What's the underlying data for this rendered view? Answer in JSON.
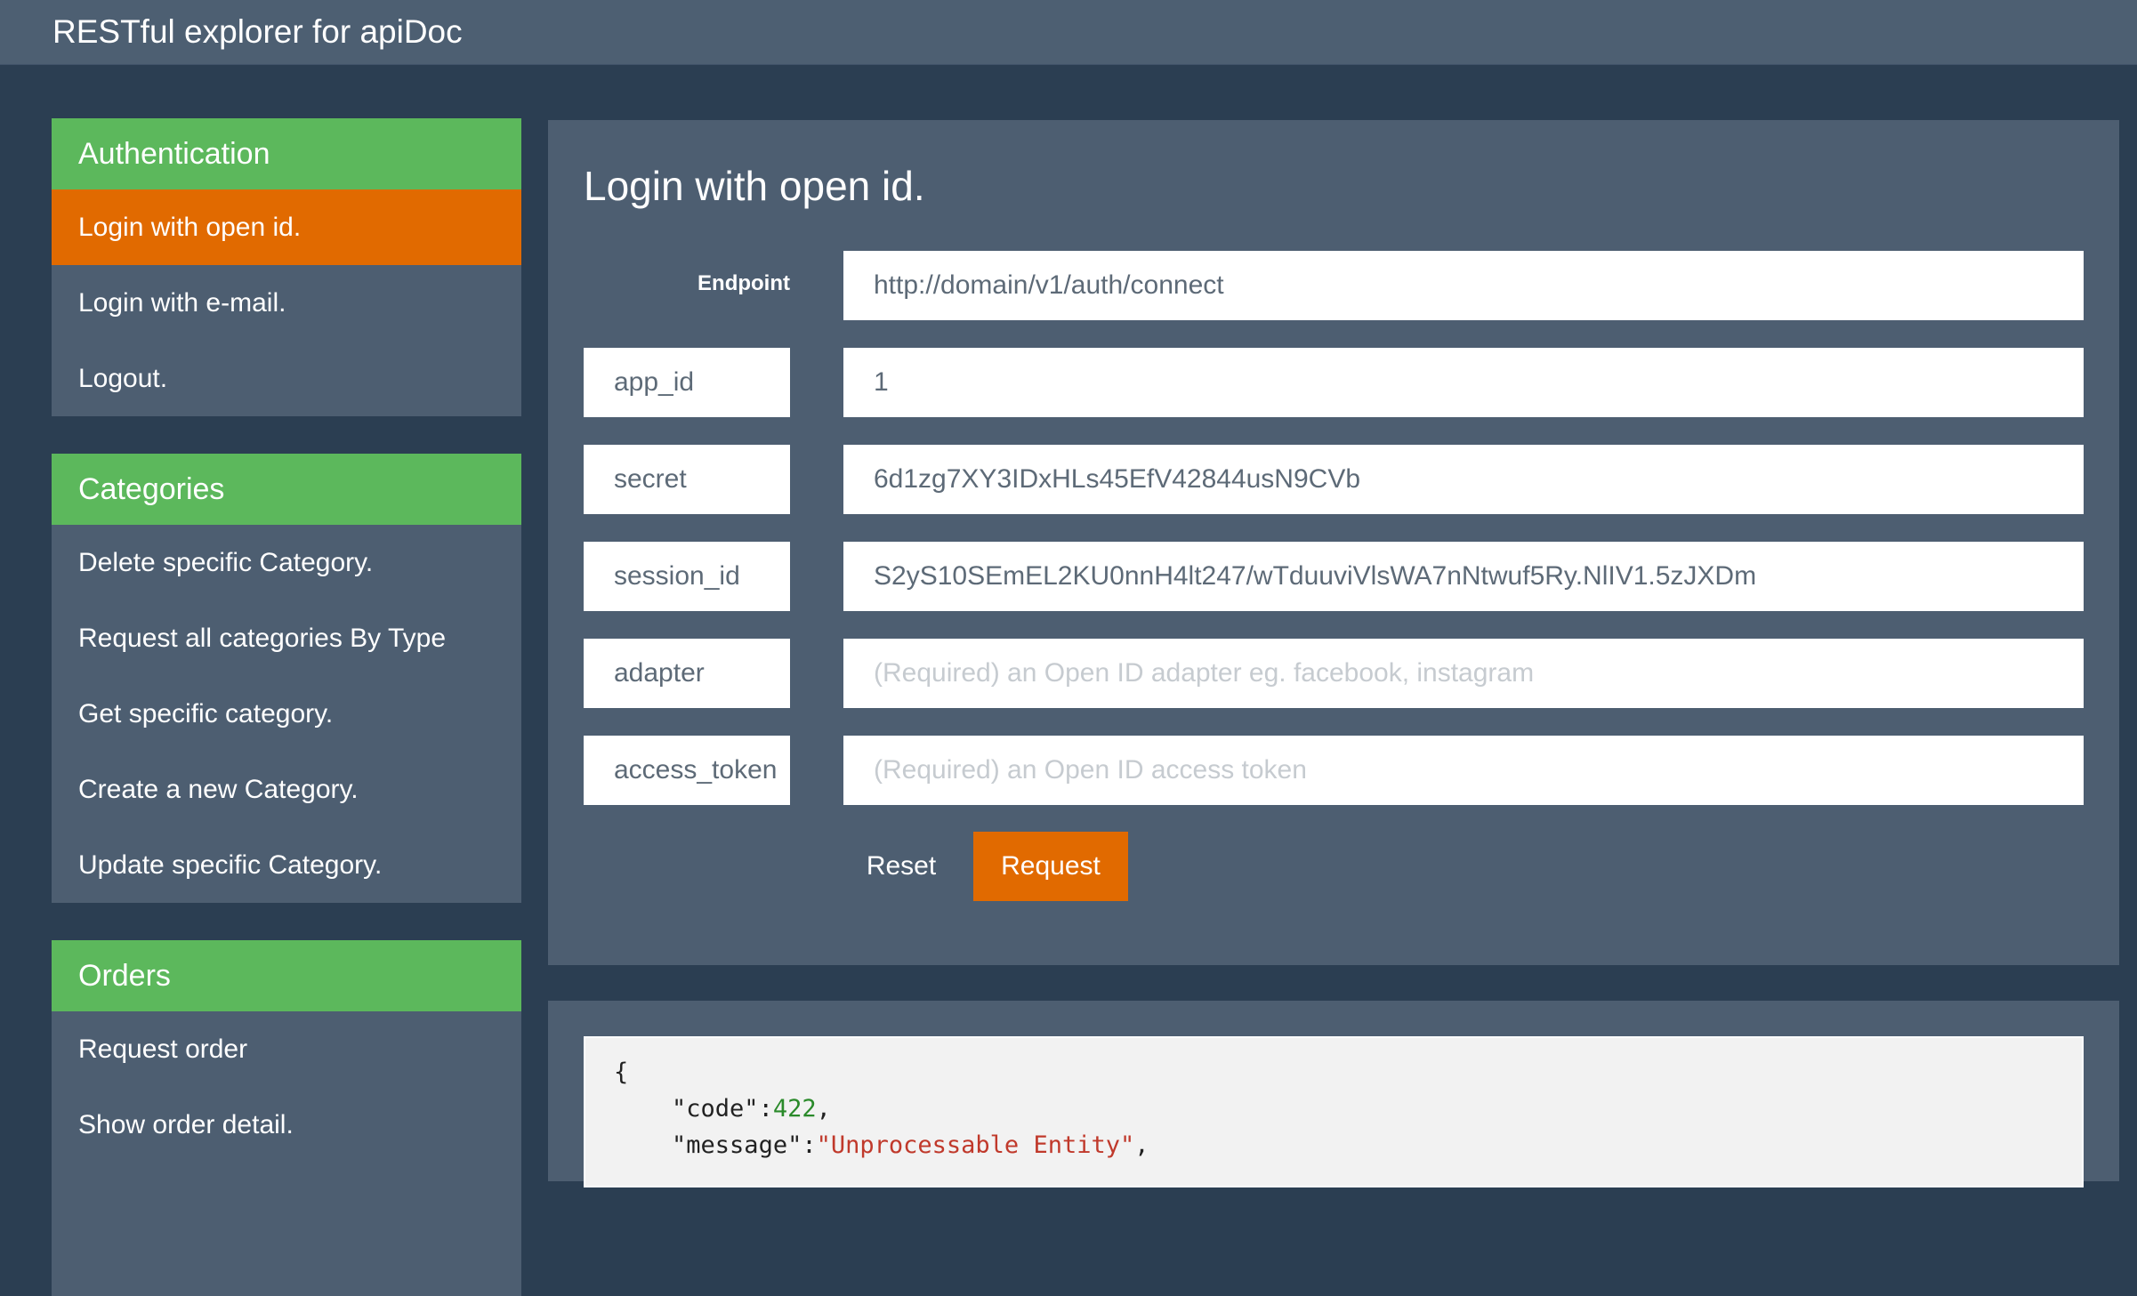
{
  "app": {
    "title": "RESTful explorer for apiDoc"
  },
  "sidebar": {
    "groups": [
      {
        "title": "Authentication",
        "items": [
          {
            "label": "Login with open id.",
            "active": true
          },
          {
            "label": "Login with e-mail."
          },
          {
            "label": "Logout."
          }
        ]
      },
      {
        "title": "Categories",
        "items": [
          {
            "label": "Delete specific Category."
          },
          {
            "label": "Request all categories By Type"
          },
          {
            "label": "Get specific category."
          },
          {
            "label": "Create a new Category."
          },
          {
            "label": "Update specific Category."
          }
        ]
      },
      {
        "title": "Orders",
        "items": [
          {
            "label": "Request order"
          },
          {
            "label": "Show order detail."
          }
        ]
      }
    ]
  },
  "main": {
    "title": "Login with open id.",
    "endpoint": {
      "label": "Endpoint",
      "value": "http://domain/v1/auth/connect"
    },
    "params": [
      {
        "name": "app_id",
        "value": "1",
        "placeholder": ""
      },
      {
        "name": "secret",
        "value": "6d1zg7XY3IDxHLs45EfV42844usN9CVb",
        "placeholder": ""
      },
      {
        "name": "session_id",
        "value": "S2yS10SEmEL2KU0nnH4lt247/wTduuviVlsWA7nNtwuf5Ry.NlIV1.5zJXDm",
        "placeholder": ""
      },
      {
        "name": "adapter",
        "value": "",
        "placeholder": "(Required) an Open ID adapter eg. facebook, instagram"
      },
      {
        "name": "access_token",
        "value": "",
        "placeholder": "(Required) an Open ID access token"
      }
    ],
    "buttons": {
      "reset": "Reset",
      "request": "Request"
    }
  },
  "response": {
    "open": "{",
    "code_key": "\"code\"",
    "code_value": "422",
    "message_key": "\"message\"",
    "message_value": "\"Unprocessable Entity\""
  },
  "colors": {
    "accent_orange": "#e16a00",
    "header_green": "#5cb85c",
    "background": "#2b3e52",
    "panel": "#4d5e71"
  }
}
